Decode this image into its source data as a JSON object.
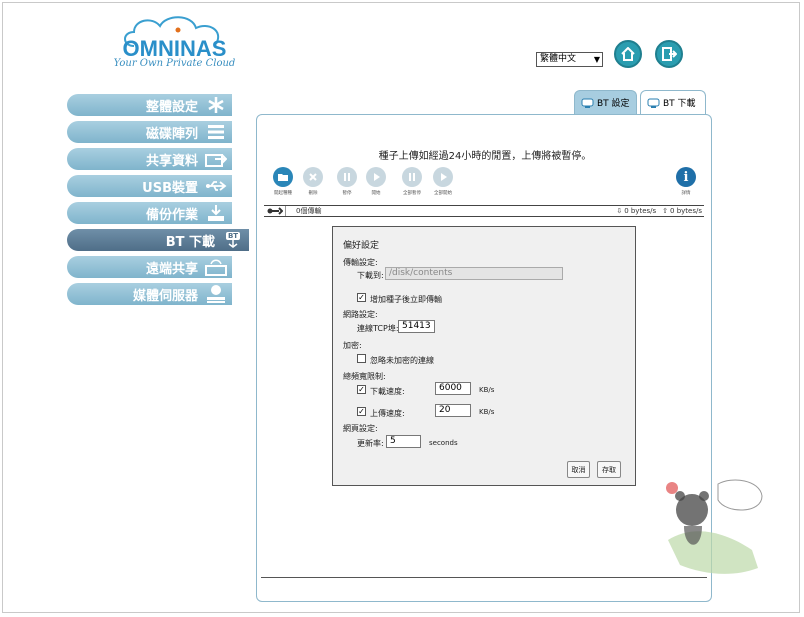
{
  "logo": {
    "name": "OMNINAS",
    "tagline": "Your Own Private Cloud"
  },
  "header": {
    "language": "繁體中文",
    "home_icon": "home-icon",
    "logout_icon": "logout-icon"
  },
  "sidebar": {
    "items": [
      {
        "label": "整體設定",
        "icon": "asterisk-icon"
      },
      {
        "label": "磁碟陣列",
        "icon": "raid-icon"
      },
      {
        "label": "共享資料",
        "icon": "share-folder-icon"
      },
      {
        "label": "USB裝置",
        "icon": "usb-icon"
      },
      {
        "label": "備份作業",
        "icon": "backup-icon"
      },
      {
        "label": "BT 下載",
        "icon": "bt-icon",
        "badge": "BT",
        "active": true
      },
      {
        "label": "遠端共享",
        "icon": "remote-share-icon"
      },
      {
        "label": "媒體伺服器",
        "icon": "media-server-icon"
      }
    ]
  },
  "tabs": {
    "settings": "BT 設定",
    "download": "BT 下載"
  },
  "panel": {
    "notice": "種子上傳如經過24小時的閒置，上傳將被暫停。",
    "toolbar": {
      "open": "開起種種",
      "remove": "刪除",
      "pause": "暫停",
      "start": "開始",
      "pause_all": "全部暫停",
      "start_all": "全部開始",
      "info": "詳情"
    },
    "status": {
      "count": "0個傳輸",
      "down": "0 bytes/s",
      "up": "0 bytes/s"
    }
  },
  "dialog": {
    "title": "偏好設定",
    "transfer_section": "傳輸設定:",
    "download_to_label": "下載到:",
    "download_to_value": "/disk/contents",
    "add_seeds_label": "增加種子後立即傳輸",
    "add_seeds_checked": true,
    "network_section": "網路設定:",
    "port_label": "連線TCP埠:",
    "port_value": "51413",
    "encryption_section": "加密:",
    "ignore_unencrypted_label": "忽略未加密的連線",
    "ignore_unencrypted_checked": false,
    "bandwidth_section": "總頻寬限制:",
    "download_speed_label": "下載速度:",
    "download_speed_value": "6000",
    "download_speed_checked": true,
    "upload_speed_label": "上傳速度:",
    "upload_speed_value": "20",
    "upload_speed_checked": true,
    "speed_unit": "KB/s",
    "web_section": "網頁設定:",
    "refresh_label": "更新率:",
    "refresh_value": "5",
    "refresh_unit": "seconds",
    "cancel": "取消",
    "save": "存取"
  },
  "colors": {
    "accent": "#2a8fc9",
    "sidebar": "#8fbcd2",
    "sidebar_active": "#5a7a94",
    "teal": "#2a9db0"
  }
}
